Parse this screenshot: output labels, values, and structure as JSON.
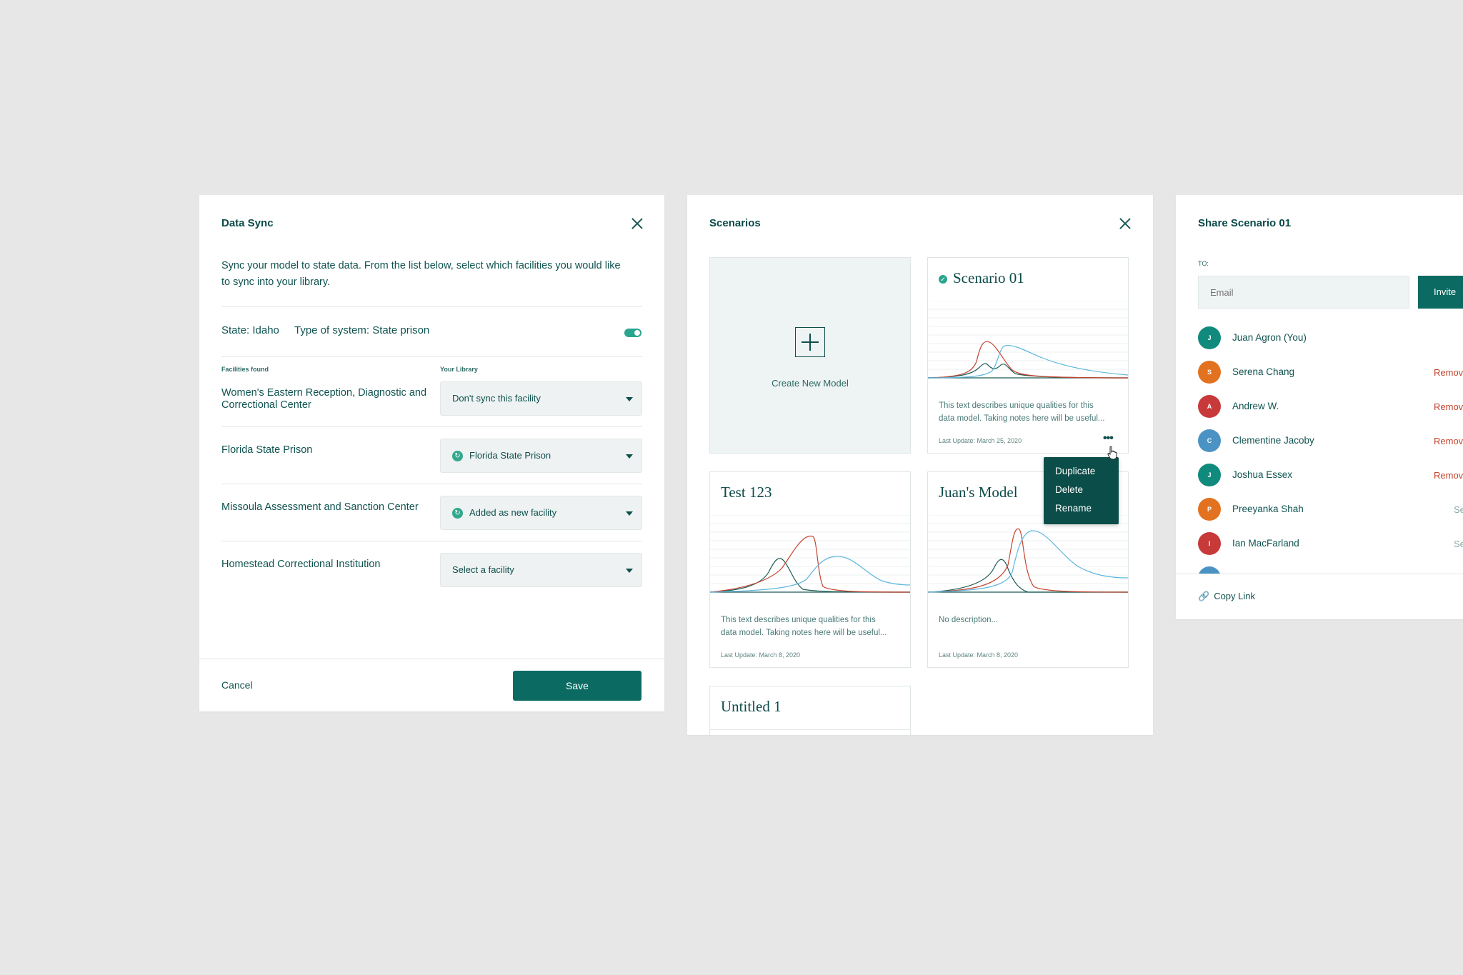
{
  "data_sync": {
    "title": "Data Sync",
    "description": "Sync your model to state data. From the list below, select which facilities you would like to sync into your library.",
    "state": "State: Idaho",
    "system_type": "Type of system: State prison",
    "facilities_header": "Facilities found",
    "library_header": "Your Library",
    "facilities": [
      {
        "name": "Women's Eastern Reception, Diagnostic and Correctional Center",
        "selection": "Don't sync this facility",
        "icon": ""
      },
      {
        "name": "Florida State Prison",
        "selection": "Florida State Prison",
        "icon": "sync-icon"
      },
      {
        "name": "Missoula Assessment and Sanction Center",
        "selection": "Added as new facility",
        "icon": "sync-icon"
      },
      {
        "name": "Homestead Correctional Institution",
        "selection": "Select a facility",
        "icon": ""
      }
    ],
    "cancel": "Cancel",
    "save": "Save"
  },
  "scenarios": {
    "title": "Scenarios",
    "create_label": "Create New Model",
    "cards": [
      {
        "title": "Scenario 01",
        "desc_line1": "This text describes unique qualities for this",
        "desc_line2": "data model. Taking notes here will be useful...",
        "date": "Last Update: March 25, 2020",
        "selected": true
      },
      {
        "title": "Test 123",
        "desc_line1": "This text describes unique qualities for this",
        "desc_line2": "data model. Taking notes here will be useful...",
        "date": "Last Update: March 8, 2020"
      },
      {
        "title": "Juan's Model",
        "desc_line1": "No description...",
        "desc_line2": "",
        "date": "Last Update: March 8, 2020"
      },
      {
        "title": "Untitled 1"
      }
    ],
    "menu": [
      "Duplicate",
      "Delete",
      "Rename"
    ],
    "colors": {
      "red": "#c4432d",
      "blue": "#5db6de",
      "dark": "#1f5a55"
    }
  },
  "share": {
    "title": "Share Scenario 01",
    "to_label": "TO:",
    "email_placeholder": "Email",
    "invite": "Invite",
    "people": [
      {
        "initial": "J",
        "name": "Juan Agron (You)",
        "action": "",
        "color": "#0f8a7d"
      },
      {
        "initial": "S",
        "name": "Serena Chang",
        "action": "Remove",
        "color": "#e2721f"
      },
      {
        "initial": "A",
        "name": "Andrew W.",
        "action": "Remove",
        "color": "#c83a3a"
      },
      {
        "initial": "C",
        "name": "Clementine Jacoby",
        "action": "Remove",
        "color": "#4b93c4"
      },
      {
        "initial": "J",
        "name": "Joshua Essex",
        "action": "Remove",
        "color": "#0f8a7d"
      },
      {
        "initial": "P",
        "name": "Preeyanka Shah",
        "action": "Se",
        "color": "#e2721f"
      },
      {
        "initial": "I",
        "name": "Ian MacFarland",
        "action": "Se",
        "color": "#c83a3a"
      }
    ],
    "copy_link": "Copy Link"
  }
}
